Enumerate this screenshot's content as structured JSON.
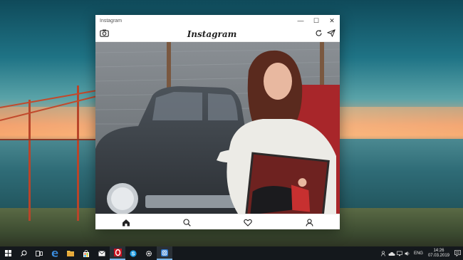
{
  "window": {
    "title": "Instagram",
    "minimize_glyph": "—",
    "maximize_glyph": "☐",
    "close_glyph": "✕"
  },
  "app": {
    "logo_text": "Instagram",
    "camera_icon": "camera-icon",
    "refresh_icon": "refresh-icon",
    "direct_icon": "send-icon"
  },
  "bottom_nav": {
    "items": [
      "home-icon",
      "search-icon",
      "heart-icon",
      "profile-icon"
    ]
  },
  "taskbar": {
    "apps": [
      "start-icon",
      "search-icon",
      "task-view-icon",
      "edge-icon",
      "file-explorer-icon",
      "store-icon",
      "mail-icon",
      "opera-icon",
      "skype-icon",
      "settings-icon",
      "instagram-app-icon"
    ],
    "tray_language": "ENG",
    "time": "14:26",
    "date": "07.03.2019"
  },
  "colors": {
    "accent": "#7ab6e8",
    "taskbar_bg": "#14181c"
  }
}
